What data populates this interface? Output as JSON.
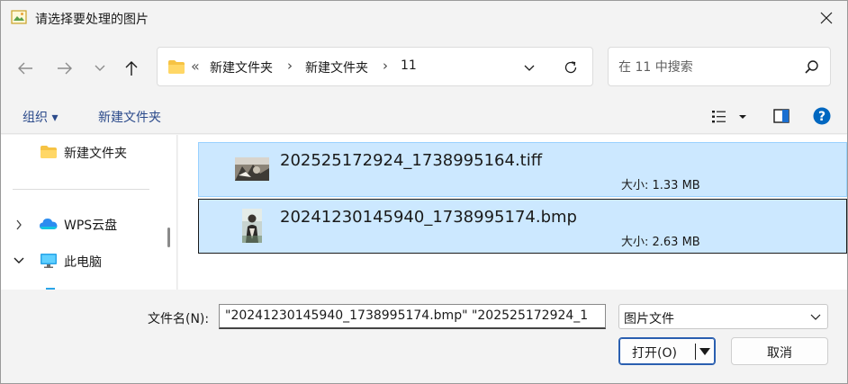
{
  "window": {
    "title": "请选择要处理的图片",
    "close_glyph": "✕"
  },
  "nav": {
    "back_glyph": "←",
    "forward_glyph": "→",
    "recent_glyph": "⌄",
    "up_glyph": "↑",
    "address": {
      "overflow_glyph": "«",
      "crumbs": [
        "新建文件夹",
        "新建文件夹",
        "11"
      ],
      "separator": "›"
    },
    "search": {
      "placeholder": "在 11 中搜索"
    }
  },
  "command_bar": {
    "organize_label": "组织 ▾",
    "new_folder_label": "新建文件夹",
    "help_glyph": "?"
  },
  "sidebar": {
    "items": [
      {
        "label": "新建文件夹",
        "icon": "folder-icon"
      },
      {
        "label": "WPS云盘",
        "icon": "cloud-icon",
        "expander": ">"
      },
      {
        "label": "此电脑",
        "icon": "computer-icon",
        "expander": "v"
      }
    ]
  },
  "files": [
    {
      "name": "202525172924_1738995164.tiff",
      "size": "大小: 1.33 MB",
      "thumb": "landscape-thumbnail",
      "focused": false
    },
    {
      "name": "20241230145940_1738995174.bmp",
      "size": "大小: 2.63 MB",
      "thumb": "portrait-thumbnail",
      "focused": true
    }
  ],
  "bottom": {
    "filename_label": "文件名(N):",
    "filename_value": "\"20241230145940_1738995174.bmp\" \"202525172924_1",
    "filetype_value": "图片文件",
    "open_label": "打开(O)",
    "cancel_label": "取消"
  },
  "colors": {
    "selection_fill": "#cce8ff",
    "selection_border": "#99d1ff",
    "accent": "#0067c0",
    "folder": "#f6c344"
  }
}
